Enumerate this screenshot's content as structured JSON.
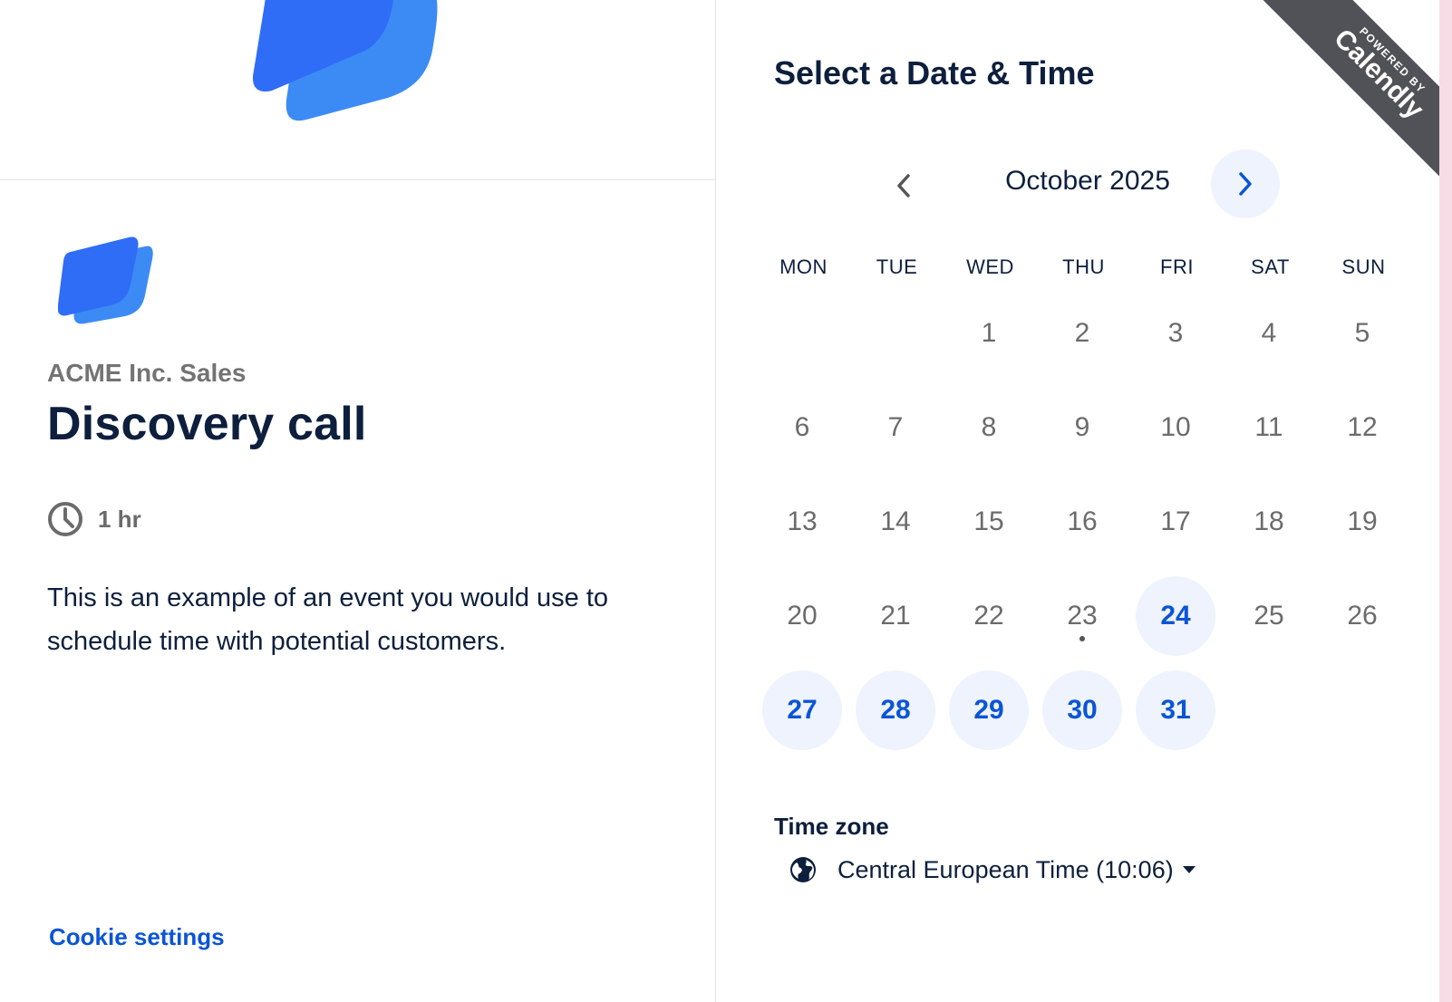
{
  "left": {
    "organization": "ACME Inc. Sales",
    "event_title": "Discovery call",
    "duration": "1 hr",
    "description": "This is an example of an event you would use to schedule time with potential customers.",
    "cookie_link": "Cookie settings",
    "brand_colors": {
      "primary": "#2f6df6",
      "secondary": "#3c8bf5"
    }
  },
  "right": {
    "title": "Select a Date & Time",
    "month_label": "October 2025",
    "prev_icon": "chevron-left-icon",
    "next_icon": "chevron-right-icon",
    "weekdays": [
      "MON",
      "TUE",
      "WED",
      "THU",
      "FRI",
      "SAT",
      "SUN"
    ],
    "weeks": [
      [
        null,
        null,
        {
          "d": "1"
        },
        {
          "d": "2"
        },
        {
          "d": "3"
        },
        {
          "d": "4"
        },
        {
          "d": "5"
        }
      ],
      [
        {
          "d": "6"
        },
        {
          "d": "7"
        },
        {
          "d": "8"
        },
        {
          "d": "9"
        },
        {
          "d": "10"
        },
        {
          "d": "11"
        },
        {
          "d": "12"
        }
      ],
      [
        {
          "d": "13"
        },
        {
          "d": "14"
        },
        {
          "d": "15"
        },
        {
          "d": "16"
        },
        {
          "d": "17"
        },
        {
          "d": "18"
        },
        {
          "d": "19"
        }
      ],
      [
        {
          "d": "20"
        },
        {
          "d": "21"
        },
        {
          "d": "22"
        },
        {
          "d": "23",
          "today": true
        },
        {
          "d": "24",
          "available": true
        },
        {
          "d": "25"
        },
        {
          "d": "26"
        }
      ],
      [
        {
          "d": "27",
          "available": true
        },
        {
          "d": "28",
          "available": true
        },
        {
          "d": "29",
          "available": true
        },
        {
          "d": "30",
          "available": true
        },
        {
          "d": "31",
          "available": true
        },
        null,
        null
      ]
    ],
    "timezone_label": "Time zone",
    "timezone_value": "Central European Time (10:06)",
    "accent_color": "#0b54d6",
    "available_bg": "#eef3fe"
  },
  "badge": {
    "powered_by": "POWERED BY",
    "brand": "Calendly"
  }
}
